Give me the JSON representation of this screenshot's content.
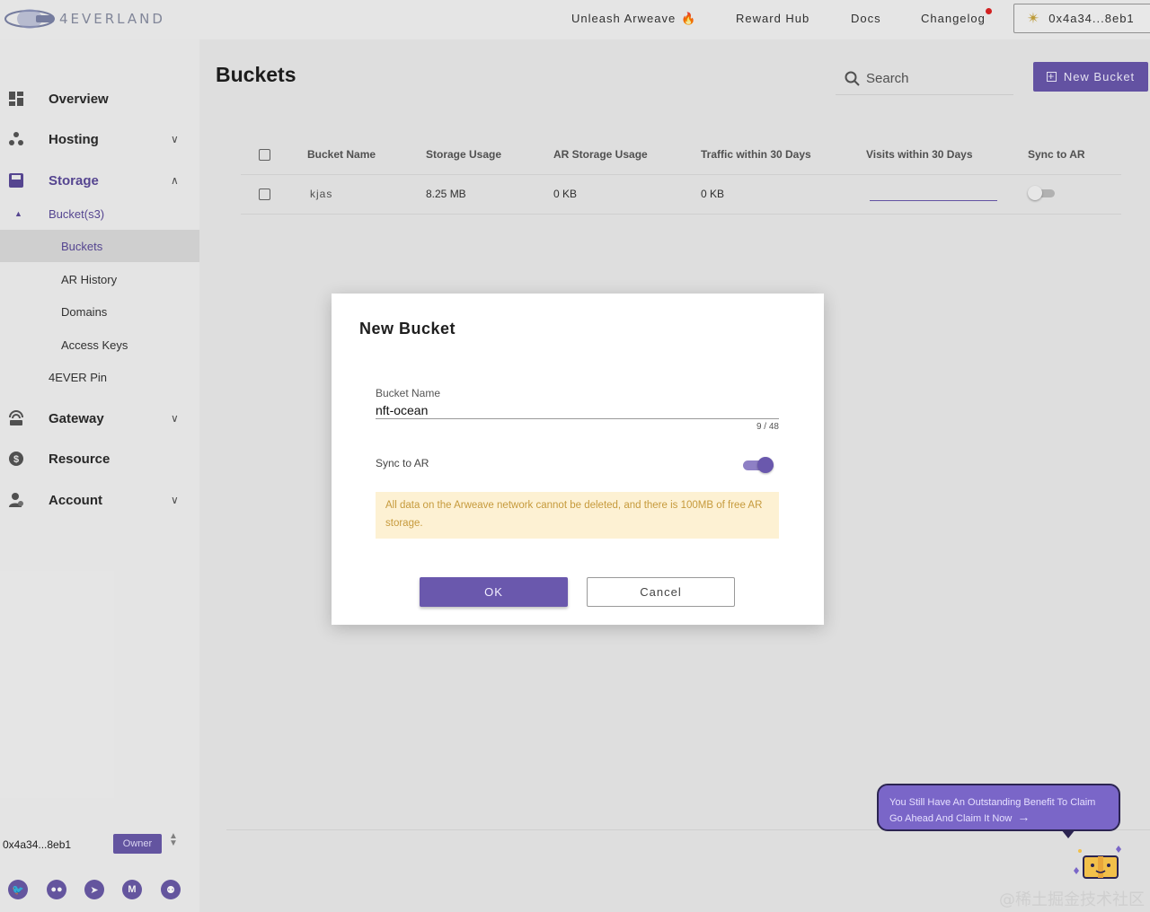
{
  "brand": {
    "logo_text": "4EVERLAND"
  },
  "topnav": {
    "items": [
      {
        "label": "Unleash Arweave",
        "icon": "fire-icon"
      },
      {
        "label": "Reward Hub"
      },
      {
        "label": "Docs"
      },
      {
        "label": "Changelog",
        "has_dot": true
      }
    ],
    "wallet_label": "0x4a34...8eb1"
  },
  "sidebar": {
    "items": [
      {
        "label": "Overview",
        "icon": "dashboard-icon"
      },
      {
        "label": "Hosting",
        "icon": "hosting-icon",
        "expandable": true
      },
      {
        "label": "Storage",
        "icon": "storage-icon",
        "expanded": true
      },
      {
        "label": "Gateway",
        "icon": "gateway-icon",
        "expandable": true
      },
      {
        "label": "Resource",
        "icon": "dollar-icon"
      },
      {
        "label": "Account",
        "icon": "account-icon",
        "expandable": true
      }
    ],
    "storage_sub": {
      "bucket_parent": "Bucket(s3)",
      "bucket_children": [
        "Buckets",
        "AR History",
        "Domains",
        "Access Keys"
      ],
      "pin": "4EVER Pin"
    },
    "footer": {
      "address": "0x4a34...8eb1",
      "role": "Owner"
    },
    "socials": [
      "twitter-icon",
      "discord-icon",
      "telegram-icon",
      "medium-icon",
      "github-icon"
    ]
  },
  "main": {
    "title": "Buckets",
    "search_placeholder": "Search",
    "new_bucket_label": "New Bucket",
    "table": {
      "columns": [
        "Bucket Name",
        "Storage Usage",
        "AR Storage Usage",
        "Traffic within 30 Days",
        "Visits within 30 Days",
        "Sync to AR"
      ],
      "rows": [
        {
          "name": "kjas",
          "storage": "8.25 MB",
          "ar_storage": "0 KB",
          "traffic": "0 KB",
          "visits": "",
          "sync": false
        }
      ]
    }
  },
  "modal": {
    "title": "New Bucket",
    "field_label": "Bucket Name",
    "field_value": "nft-ocean",
    "counter": "9 / 48",
    "sync_label": "Sync to AR",
    "sync_on": true,
    "warning": "All data on the Arweave network cannot be deleted, and there is 100MB of free AR storage.",
    "ok_label": "OK",
    "cancel_label": "Cancel"
  },
  "claim_banner": {
    "line1": "You Still Have An Outstanding Benefit To Claim",
    "line2": "Go Ahead And Claim It Now"
  },
  "watermark": "@稀土掘金技术社区",
  "colors": {
    "accent": "#6a58ad",
    "warning_bg": "#fdf1d3",
    "warning_text": "#c69a3c"
  }
}
